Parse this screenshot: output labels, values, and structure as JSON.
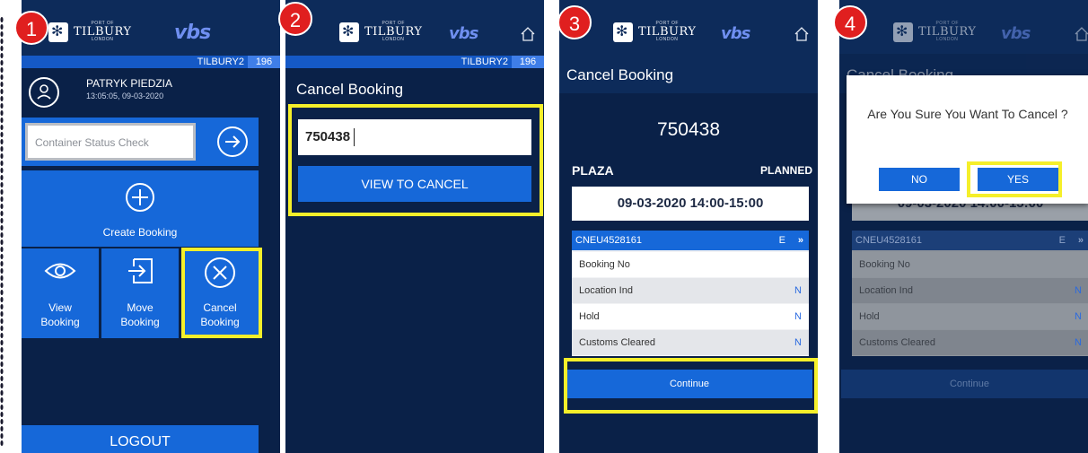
{
  "colors": {
    "panel_bg": "#0a2148",
    "accent": "#1668d9",
    "highlight": "#f5ef2a",
    "badge": "#e01f1f"
  },
  "logo": {
    "small": "PORT OF",
    "big": "TILBURY",
    "sub": "LONDON"
  },
  "vbs": "vbs",
  "header": {
    "terminal": "TILBURY2",
    "terminal_num": "196"
  },
  "steps": [
    "1",
    "2",
    "3",
    "4"
  ],
  "screen1": {
    "user_name": "PATRYK PIEDZIA",
    "timestamp": "13:05:05, 09-03-2020",
    "status_placeholder": "Container Status Check",
    "create": "Create Booking",
    "view": "View\nBooking",
    "move": "Move\nBooking",
    "cancel": "Cancel\nBooking",
    "logout": "LOGOUT"
  },
  "screen2": {
    "title": "Cancel Booking",
    "input_value": "750438",
    "button": "VIEW TO CANCEL"
  },
  "screen3": {
    "title": "Cancel Booking",
    "booking_number": "750438",
    "plaza": "PLAZA",
    "status": "PLANNED",
    "slot": "09-03-2020 14:00-15:00",
    "container": "CNEU4528161",
    "container_flag": "E",
    "rows": [
      {
        "label": "Booking No",
        "value": ""
      },
      {
        "label": "Location Ind",
        "value": "N"
      },
      {
        "label": "Hold",
        "value": "N"
      },
      {
        "label": "Customs Cleared",
        "value": "N"
      }
    ],
    "continue": "Continue"
  },
  "screen4": {
    "title": "Cancel Booking",
    "dialog_text": "Are You Sure You Want To Cancel ?",
    "no": "NO",
    "yes": "YES",
    "slot_partial": "09-03-2020 14:00-15:00",
    "container": "CNEU4528161",
    "container_flag": "E",
    "rows": [
      {
        "label": "Booking No",
        "value": ""
      },
      {
        "label": "Location Ind",
        "value": "N"
      },
      {
        "label": "Hold",
        "value": "N"
      },
      {
        "label": "Customs Cleared",
        "value": "N"
      }
    ],
    "continue": "Continue"
  }
}
